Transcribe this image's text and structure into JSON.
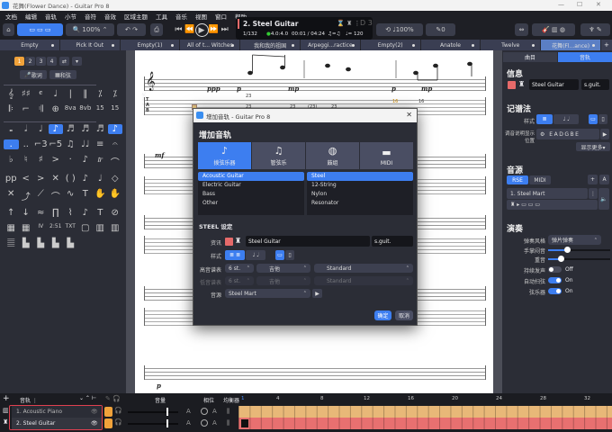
{
  "window": {
    "title": "花舞(Flower Dance) - Guitar Pro 8",
    "controls": [
      "—",
      "☐",
      "✕"
    ]
  },
  "menu": [
    "文档",
    "编辑",
    "音轨",
    "小节",
    "音符",
    "音效",
    "区域主题",
    "工具",
    "音乐",
    "视图",
    "窗口",
    "帮助"
  ],
  "toolbar": {
    "zoom": "100%",
    "speed": "100%",
    "pick_value": "0"
  },
  "lcd": {
    "track": "2. Steel Guitar",
    "bar": "1/132",
    "signature": "4.0:4.0",
    "time": "00:01 / 04:24",
    "tempo": "♩= 120",
    "triplet": "♫=♫",
    "key": "D 3"
  },
  "score_tabs": [
    {
      "label": "Empty"
    },
    {
      "label": "Pick It Out"
    },
    {
      "label": "Empty(1)"
    },
    {
      "label": "All of t... Witches"
    },
    {
      "label": "我和我的祖国"
    },
    {
      "label": "Arpeggi...ractice"
    },
    {
      "label": "Empty(2)"
    },
    {
      "label": "Anatole"
    },
    {
      "label": "Twelve"
    },
    {
      "label": "花舞(Fl...ance)",
      "active": true
    }
  ],
  "left_panel": {
    "voices": [
      "1",
      "2",
      "3",
      "4"
    ],
    "lyrics": "歌词",
    "chord": "和弦"
  },
  "score": {
    "track_abbr": "s.guit.",
    "dynamics": [
      "ppp",
      "p",
      "mp",
      "p",
      "mp"
    ],
    "tab_numbers": [
      "23",
      "23",
      "23",
      "(23)",
      "23",
      "16",
      "16"
    ],
    "dynamics2": [
      "mf",
      "p"
    ]
  },
  "dialog": {
    "title": "增加音轨 - Guitar Pro 8",
    "heading": "增加音轨",
    "categories": [
      {
        "label": "拨弦乐器",
        "icon": "guitar-icon",
        "selected": true
      },
      {
        "label": "管弦乐",
        "icon": "saxophone-icon"
      },
      {
        "label": "鼓组",
        "icon": "drums-icon"
      },
      {
        "label": "MIDI",
        "icon": "midi-icon"
      }
    ],
    "families": [
      {
        "label": "Acoustic Guitar",
        "selected": true
      },
      {
        "label": "Electric Guitar"
      },
      {
        "label": "Bass"
      },
      {
        "label": "Other"
      }
    ],
    "instruments": [
      {
        "label": "Steel",
        "selected": true
      },
      {
        "label": "12-String"
      },
      {
        "label": "Nylon"
      },
      {
        "label": "Resonator"
      }
    ],
    "settings_heading": "STEEL 设定",
    "info_label": "资讯",
    "name": "Steel Guitar",
    "short_name": "s.guit.",
    "style_label": "样式",
    "treble_label": "高音谱表",
    "treble_strings": "6 st.",
    "treble_instrument": "吉他",
    "treble_tuning": "Standard",
    "bass_label": "低音谱表",
    "bass_strings": "6 st.",
    "bass_instrument": "吉他",
    "bass_tuning": "Standard",
    "sound_label": "音源",
    "sound": "Steel Mart",
    "ok": "确定",
    "cancel": "取消",
    "track_color": "#e66a6a"
  },
  "right_panel": {
    "tabs": [
      {
        "label": "曲目"
      },
      {
        "label": "音轨",
        "active": true
      }
    ],
    "info_heading": "信息",
    "name": "Steel Guitar",
    "short_name": "s.guit.",
    "notation_heading": "记谱法",
    "style_label": "样式",
    "tuning_label": "调音说明显示位置",
    "tuning": "EADGBE",
    "show_more": "显示更多▾",
    "sound_heading": "音源",
    "rse": "RSE",
    "midi": "MIDI",
    "sound": "1. Steel Mart",
    "play_heading": "演奏",
    "play_style_label": "弹奏风格",
    "play_style": "弹片弹奏",
    "palm_mute_label": "手掌闷音",
    "palm_mute": 0.5,
    "accent_label": "重音",
    "accent": 0.3,
    "sustain_label": "持续发声",
    "sustain": "Off",
    "auto_strum_label": "自动扫弦",
    "auto_strum": "On",
    "strings_label": "弦乐器",
    "strings": "On"
  },
  "bottom": {
    "headers": {
      "tracks": "音轨",
      "volume": "音量",
      "pan": "相位",
      "eq": "均衡器"
    },
    "tracks": [
      {
        "name": "1. Acoustic Piano",
        "color": "#e8b878"
      },
      {
        "name": "2. Steel Guitar",
        "color": "#e87070"
      }
    ],
    "ruler": [
      "1",
      "4",
      "8",
      "12",
      "16",
      "20",
      "24",
      "28",
      "32"
    ]
  },
  "colors": {
    "accent": "#3d7ef0",
    "highlight": "#f0a23a"
  }
}
